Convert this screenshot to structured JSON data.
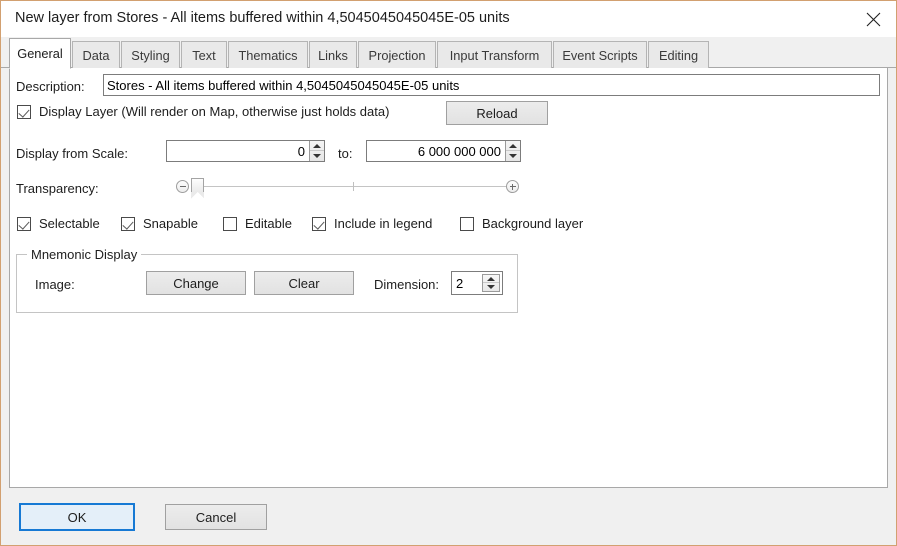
{
  "window": {
    "title": "New layer from Stores - All items buffered within 4,5045045045045E-05 units",
    "close_icon": "close-icon"
  },
  "tabs": [
    {
      "label": "General",
      "active": true
    },
    {
      "label": "Data",
      "active": false
    },
    {
      "label": "Styling",
      "active": false
    },
    {
      "label": "Text",
      "active": false
    },
    {
      "label": "Thematics",
      "active": false
    },
    {
      "label": "Links",
      "active": false
    },
    {
      "label": "Projection",
      "active": false
    },
    {
      "label": "Input Transform",
      "active": false
    },
    {
      "label": "Event Scripts",
      "active": false
    },
    {
      "label": "Editing",
      "active": false
    }
  ],
  "general": {
    "description_label": "Description:",
    "description_value": "Stores - All items buffered within 4,5045045045045E-05 units",
    "display_layer_label": "Display Layer (Will render on Map, otherwise just holds data)",
    "display_layer_checked": true,
    "reload_label": "Reload",
    "scale_from_label": "Display from Scale:",
    "scale_from_value": "0",
    "scale_to_label": "to:",
    "scale_to_value": "6 000 000 000",
    "transparency_label": "Transparency:",
    "transparency_value": 0,
    "flags": [
      {
        "label": "Selectable",
        "checked": true
      },
      {
        "label": "Snapable",
        "checked": true
      },
      {
        "label": "Editable",
        "checked": false
      },
      {
        "label": "Include in legend",
        "checked": true
      },
      {
        "label": "Background layer",
        "checked": false
      }
    ],
    "mnemonic": {
      "group_title": "Mnemonic Display",
      "image_label": "Image:",
      "change_label": "Change",
      "clear_label": "Clear",
      "dimension_label": "Dimension:",
      "dimension_value": "2"
    }
  },
  "footer": {
    "ok_label": "OK",
    "cancel_label": "Cancel"
  },
  "colors": {
    "window_border": "#d2a070",
    "accent_focus": "#1679d4",
    "panel_bg": "#ffffff",
    "chrome_bg": "#f0f0f0"
  }
}
